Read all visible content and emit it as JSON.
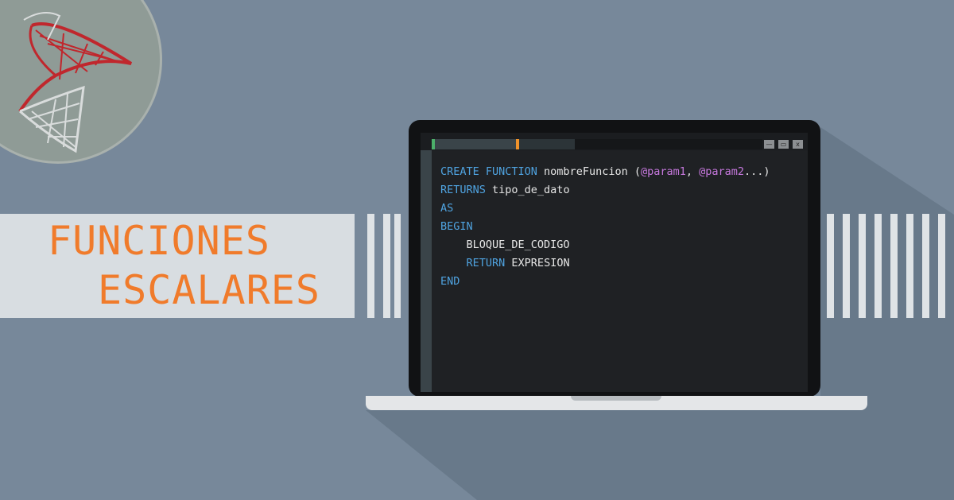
{
  "title": {
    "line1": "FUNCIONES",
    "line2": "ESCALARES"
  },
  "colors": {
    "background": "#77889a",
    "accent": "#f07b2b",
    "banner": "#d8dde1",
    "keyword": "#4fa3e0",
    "parameter": "#c678dd",
    "code_text": "#e6e6e6"
  },
  "logo": {
    "icon": "sql-server-logo"
  },
  "window_controls": {
    "minimize": "—",
    "restore": "▭",
    "close": "x"
  },
  "code": {
    "line1": {
      "kw1": "CREATE FUNCTION",
      "name": " nombreFuncion (",
      "p1": "@param1",
      "sep": ", ",
      "p2": "@param2",
      "end": "...)"
    },
    "line2": {
      "kw": "RETURNS",
      "type": " tipo_de_dato"
    },
    "line3": {
      "kw": "AS"
    },
    "line4": {
      "kw": "BEGIN"
    },
    "line5": {
      "text": "    BLOQUE_DE_CODIGO"
    },
    "line6": {
      "indent": "    ",
      "kw": "RETURN",
      "text": " EXPRESION"
    },
    "line7": {
      "kw": "END"
    }
  }
}
